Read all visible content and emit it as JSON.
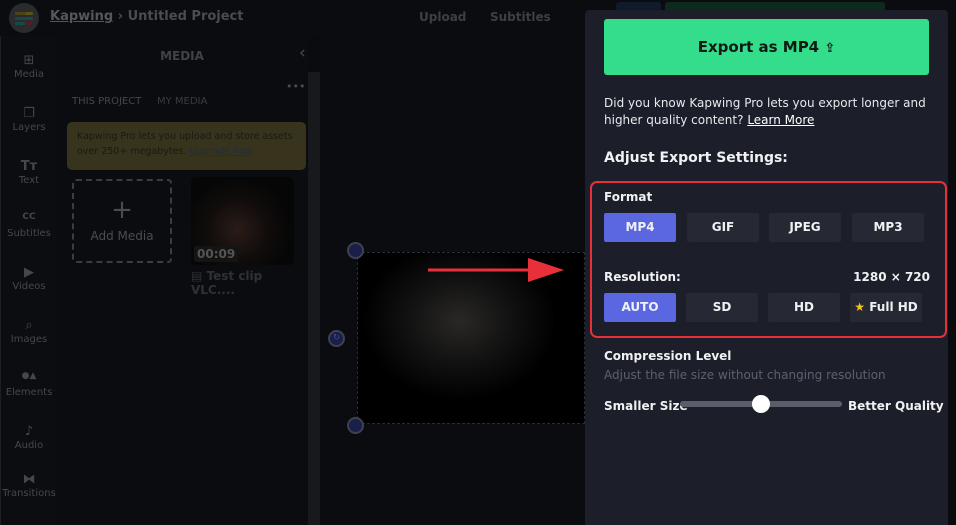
{
  "header": {
    "brand": "Kapwing",
    "separator": "›",
    "project": "Untitled Project",
    "nav": [
      "Upload",
      "Subtitles"
    ]
  },
  "rail": [
    {
      "label": "Media",
      "icon": "media-plus-icon",
      "glyph": "⊞"
    },
    {
      "label": "Layers",
      "icon": "layers-icon",
      "glyph": "❐"
    },
    {
      "label": "Text",
      "icon": "text-icon",
      "glyph": "Tт"
    },
    {
      "label": "Subtitles",
      "icon": "cc-icon",
      "glyph": "CC"
    },
    {
      "label": "Videos",
      "icon": "video-play-icon",
      "glyph": "▶"
    },
    {
      "label": "Images",
      "icon": "search-icon",
      "glyph": "⌕"
    },
    {
      "label": "Elements",
      "icon": "shapes-icon",
      "glyph": "●▲"
    },
    {
      "label": "Audio",
      "icon": "music-note-icon",
      "glyph": "♪"
    },
    {
      "label": "Transitions",
      "icon": "transition-icon",
      "glyph": "⧓"
    }
  ],
  "media": {
    "title": "MEDIA",
    "tabs": [
      "THIS PROJECT",
      "MY MEDIA"
    ],
    "banner_text": "Kapwing Pro lets you upload and store assets over 250+ megabytes.",
    "banner_link": "Upgrade now",
    "add_label": "Add Media",
    "clip_duration": "00:09",
    "clip_name": "Test clip VLC...."
  },
  "export": {
    "button_label": "Export as MP4",
    "info_text": "Did you know Kapwing Pro lets you export longer and higher quality content?",
    "info_link": "Learn More",
    "settings_heading": "Adjust Export Settings:",
    "format_label": "Format",
    "formats": [
      "MP4",
      "GIF",
      "JPEG",
      "MP3"
    ],
    "selected_format": "MP4",
    "resolution_label": "Resolution:",
    "resolution_value": "1280 × 720",
    "resolutions": [
      "AUTO",
      "SD",
      "HD",
      "Full HD"
    ],
    "selected_resolution": "AUTO",
    "compression_label": "Compression Level",
    "compression_sub": "Adjust the file size without changing resolution",
    "slider_min_label": "Smaller Size",
    "slider_max_label": "Better Quality",
    "compression_value_percent": 50
  },
  "colors": {
    "accent_green": "#33dd8c",
    "selected": "#5a67e0",
    "highlight_box": "#e8303a",
    "arrow": "#e8303a"
  }
}
